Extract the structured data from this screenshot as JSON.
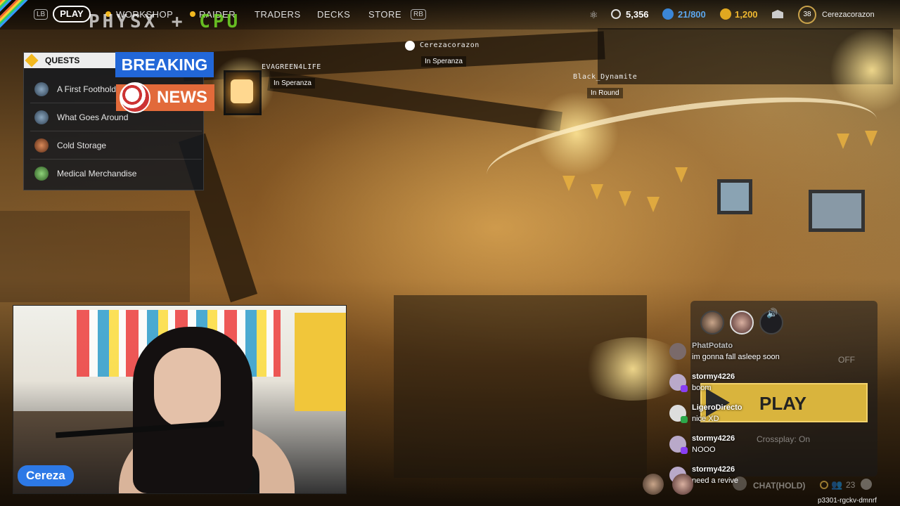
{
  "topbar": {
    "lb": "LB",
    "rb": "RB",
    "play": "PLAY",
    "nav": [
      "WORKSHOP",
      "RAIDER",
      "TRADERS",
      "DECKS",
      "STORE"
    ],
    "overlay_left": "PHYSX",
    "overlay_right": "CPU",
    "coins": "5,356",
    "inventory": "21/800",
    "raider_tokens": "1,200",
    "level": "38",
    "username": "Cerezacorazon"
  },
  "quests": {
    "title": "QUESTS",
    "items": [
      {
        "label": "A First Foothold"
      },
      {
        "label": "What Goes Around"
      },
      {
        "label": "Cold Storage"
      },
      {
        "label": "Medical Merchandise"
      }
    ]
  },
  "news_banner": {
    "breaking": "BREAKING",
    "news": "NEWS"
  },
  "players": [
    {
      "name": "EVAGREEN4LIFE",
      "status": "In Speranza"
    },
    {
      "name": "Cerezacorazon",
      "status": "In Speranza"
    },
    {
      "name": "Black_Dynamite",
      "status": "In Round"
    }
  ],
  "webcam": {
    "streamer_name": "Cereza"
  },
  "party": {
    "off_label": "OFF",
    "play_button": "PLAY",
    "crossplay": "Crossplay: On",
    "chat_hold": "CHAT(HOLD)",
    "player_count": "23",
    "session_code": "p3301-rgckv-dmnrf"
  },
  "chat": [
    {
      "name": "PhatPotato",
      "text": "im gonna fall asleep soon"
    },
    {
      "name": "stormy4226",
      "text": "boom"
    },
    {
      "name": "LigeroDirecto",
      "text": "nice XD"
    },
    {
      "name": "stormy4226",
      "text": "NOOO"
    },
    {
      "name": "stormy4226",
      "text": "need a revive"
    }
  ]
}
